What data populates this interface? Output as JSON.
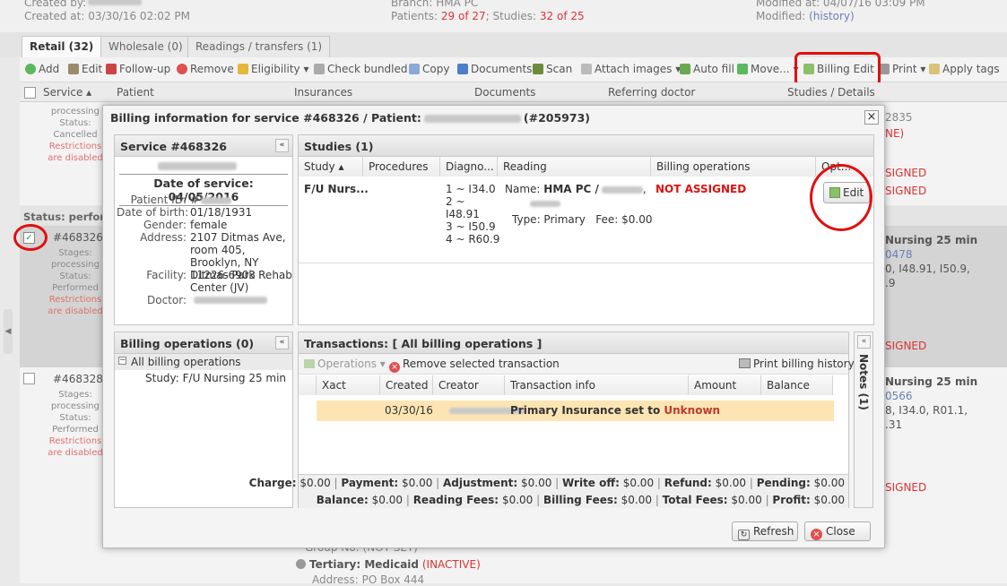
{
  "top_info": {
    "created_by_label": "Created by:",
    "created_at": "Created at: 03/30/16 02:02 PM",
    "branch_label": "Branch:",
    "branch_value": "HMA PC",
    "patients_label": "Patients:",
    "patients_value": "29 of 27",
    "studies_label": "; Studies:",
    "studies_value": "32 of 25",
    "modified_at": "Modified at: 04/07/16 03:09 PM",
    "modified_label": "Modified:",
    "modified_link": "(history)"
  },
  "tabs": [
    {
      "label": "Retail (32)"
    },
    {
      "label": "Wholesale (0)"
    },
    {
      "label": "Readings / transfers (1)"
    }
  ],
  "toolbar": {
    "add": "Add",
    "edit": "Edit",
    "follow_up": "Follow-up",
    "remove": "Remove",
    "eligibility": "Eligibility",
    "check_bundled": "Check bundled",
    "copy": "Copy",
    "documents": "Documents",
    "scan": "Scan",
    "attach_images": "Attach images",
    "auto_fill": "Auto fill",
    "move": "Move...",
    "billing_edit": "Billing Edit",
    "print": "Print",
    "apply_tags": "Apply tags"
  },
  "grid_columns": [
    "Service",
    "Patient",
    "Insurances",
    "Documents",
    "Referring doctor",
    "Studies / Details"
  ],
  "background": {
    "row1": {
      "stages": "Stages:",
      "stage_val": "processing",
      "status": "Status:",
      "status_val": "Cancelled",
      "restr1": "Restrictions",
      "restr2": "are disabled",
      "right_num": "2835",
      "right_ne": "NE)",
      "right_signed1": "SIGNED",
      "right_signed2": "SIGNED"
    },
    "group_label": "Status: perform",
    "row2": {
      "id": "#468326",
      "stages": "Stages:",
      "stage_val": "processing",
      "status": "Status:",
      "status_val": "Performed",
      "restr1": "Restrictions",
      "restr2": "are disabled",
      "r1": "Nursing 25 min",
      "r2": "0478",
      "r3": "0, I48.91, I50.9,",
      "r4": ".9",
      "r5": "SIGNED"
    },
    "row3": {
      "id": "#468328",
      "stages": "Stages:",
      "stage_val": "processing",
      "status": "Status:",
      "status_val": "Performed",
      "restr1": "Restrictions",
      "restr2": "are disabled",
      "r1": "Nursing 25 min",
      "r2": "0566",
      "r3": "8, I34.0, R01.1,",
      "r4": ".31",
      "r5": "SIGNED"
    },
    "bottom": {
      "group_no": "Group No: (NOT SET)",
      "tertiary": "Tertiary: Medicaid",
      "inactive": "(INACTIVE)",
      "address": "Address: PO Box 444"
    }
  },
  "modal": {
    "title_prefix": "Billing information for service #468326 / Patient:",
    "title_suffix": "(#205973)",
    "close_x": "×",
    "service_panel": {
      "title": "Service #468326",
      "date_of_service": "Date of service: 04/05/2016",
      "fields": [
        {
          "label": "Patient ID:",
          "value": "#"
        },
        {
          "label": "Date of birth:",
          "value": "01/18/1931"
        },
        {
          "label": "Gender:",
          "value": "female"
        },
        {
          "label": "Address:",
          "value": "2107 Ditmas Ave, room 405, Brooklyn, NY 11226-6903"
        },
        {
          "label": "Facility:",
          "value": "Ditmas Park Rehab Center (JV)"
        },
        {
          "label": "Doctor:",
          "value": ""
        }
      ]
    },
    "studies_panel": {
      "title": "Studies (1)",
      "columns": [
        "Study",
        "Procedures",
        "Diagno...",
        "Reading",
        "Billing operations",
        "Opt..."
      ],
      "row": {
        "study": "F/U Nurs...",
        "diagnoses": [
          "1 ~ I34.0",
          "2 ~",
          "I48.91",
          "3 ~ I50.9",
          "4 ~ R60.9"
        ],
        "reading_name_label": "Name:",
        "reading_name": "HMA PC /",
        "reading_type": "Type: Primary",
        "reading_fee": "Fee: $0.00",
        "billing_status": "NOT ASSIGNED",
        "edit_label": "Edit"
      }
    },
    "billing_ops_panel": {
      "title": "Billing operations (0)",
      "tree_root": "All billing operations",
      "tree_child": "Study: F/U Nursing 25 min"
    },
    "transactions_panel": {
      "title": "Transactions: [ All billing operations ]",
      "operations": "Operations",
      "remove_selected": "Remove selected transaction",
      "print_history": "Print billing history",
      "columns": [
        "Xact",
        "Created",
        "Creator",
        "Transaction info",
        "Amount",
        "Balance"
      ],
      "row": {
        "created": "03/30/16",
        "info_prefix": "Primary Insurance set to",
        "info_value": "Unknown"
      },
      "summary1": [
        {
          "label": "Charge:",
          "value": "$0.00"
        },
        {
          "label": "Payment:",
          "value": "$0.00"
        },
        {
          "label": "Adjustment:",
          "value": "$0.00"
        },
        {
          "label": "Write off:",
          "value": "$0.00"
        },
        {
          "label": "Refund:",
          "value": "$0.00"
        },
        {
          "label": "Pending:",
          "value": "$0.00"
        }
      ],
      "summary2": [
        {
          "label": "Balance:",
          "value": "$0.00"
        },
        {
          "label": "Reading Fees:",
          "value": "$0.00"
        },
        {
          "label": "Billing Fees:",
          "value": "$0.00"
        },
        {
          "label": "Total Fees:",
          "value": "$0.00"
        },
        {
          "label": "Profit:",
          "value": "$0.00"
        }
      ]
    },
    "notes_tab": "Notes (1)",
    "refresh": "Refresh",
    "close": "Close"
  },
  "colors": {
    "accent_red": "#e01010",
    "link_blue": "#6a7fb5",
    "highlight_row": "#fde5b3"
  }
}
